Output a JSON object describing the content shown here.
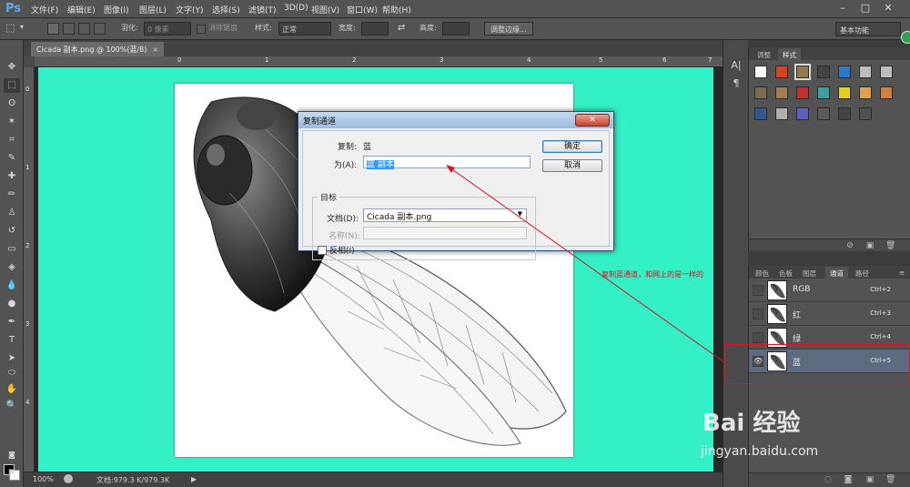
{
  "app": {
    "logo": "Ps",
    "menu": [
      "文件(F)",
      "编辑(E)",
      "图像(I)",
      "图层(L)",
      "文字(Y)",
      "选择(S)",
      "滤镜(T)",
      "3D(D)",
      "视图(V)",
      "窗口(W)",
      "帮助(H)"
    ],
    "window_controls": [
      "–",
      "□",
      "✕"
    ]
  },
  "options_bar": {
    "feather_label": "羽化:",
    "feather_value": "0 像素",
    "antialias_label": "消除锯齿",
    "style_label": "样式:",
    "style_value": "正常",
    "width_label": "宽度:",
    "height_label": "高度:",
    "refine_edge": "调整边缘...",
    "workspace": "基本功能"
  },
  "document": {
    "tab_title": "Cicada 副本.png @ 100%(蓝/8)",
    "tab_close": "×",
    "canvas_color": "#34f0c6"
  },
  "rulers": {
    "h_ticks": [
      "0",
      "1",
      "2",
      "3",
      "4",
      "5",
      "6",
      "7"
    ],
    "v_ticks": [
      "0",
      "1",
      "2",
      "3",
      "4"
    ]
  },
  "status": {
    "zoom": "100%",
    "doc_info": "文档:979.3 K/979.3K",
    "arrow": "▶"
  },
  "dialog": {
    "title": "复制通道",
    "close": "✕",
    "copy_label": "复制:",
    "copy_value": "蓝",
    "as_label": "为(A):",
    "as_value": "蓝 副本",
    "group_title": "目标",
    "doc_label": "文档(D):",
    "doc_value": "Cicada 副本.png",
    "name_label": "名称(N):",
    "invert_label": "反相(I)",
    "ok": "确定",
    "cancel": "取消"
  },
  "annotation": {
    "text": "复制蓝通道，和网上的是一样的"
  },
  "style_panel": {
    "tabs": [
      "调整",
      "样式"
    ],
    "swatches": [
      "#ffffff",
      "#d9401c",
      "#8e7b4a",
      "#444444",
      "#2f78c8",
      "#bdbdbd",
      "#bdbdbd",
      "#7a6a50",
      "#a08050",
      "#c03030",
      "#3aa0a0",
      "#e0d020",
      "#e0a050",
      "#d08040",
      "#305890",
      "#b0b0b0",
      "#6060c0",
      "#5a5a5a",
      "#444444",
      "#505050"
    ]
  },
  "channels_panel": {
    "tabs": [
      "颜色",
      "色板",
      "图层",
      "通道",
      "路径"
    ],
    "channels": [
      {
        "name": "RGB",
        "shortcut": "Ctrl+2",
        "visible": "",
        "selected": false
      },
      {
        "name": "红",
        "shortcut": "Ctrl+3",
        "visible": "",
        "selected": false
      },
      {
        "name": "绿",
        "shortcut": "Ctrl+4",
        "visible": "",
        "selected": false
      },
      {
        "name": "蓝",
        "shortcut": "Ctrl+5",
        "visible": "👁",
        "selected": true
      }
    ]
  },
  "watermark": {
    "logo": "Bai 经验",
    "url": "jingyan.baidu.com"
  }
}
